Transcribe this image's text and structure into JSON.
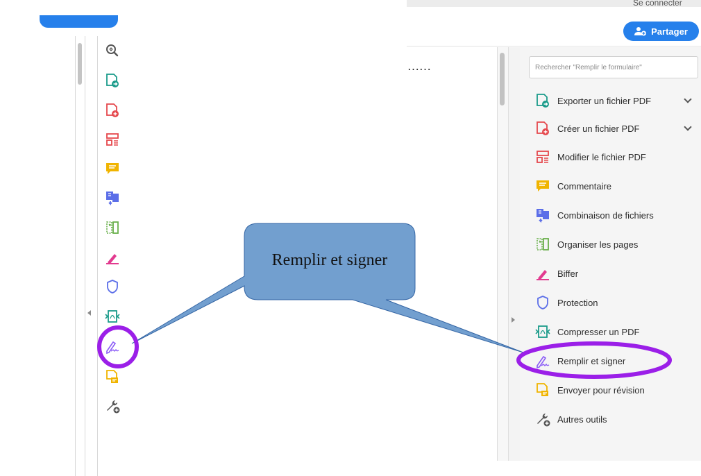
{
  "header": {
    "top_link": "Se connecter",
    "share_label": "Partager"
  },
  "document": {
    "visible_text": "……"
  },
  "tools_pane": {
    "search_placeholder": "Rechercher \"Remplir le formulaire\"",
    "items": [
      {
        "label": "Exporter un fichier PDF",
        "icon": "export-pdf-icon",
        "has_chevron": true
      },
      {
        "label": "Créer un fichier PDF",
        "icon": "create-pdf-icon",
        "has_chevron": true
      },
      {
        "label": "Modifier le fichier PDF",
        "icon": "edit-pdf-icon",
        "has_chevron": false
      },
      {
        "label": "Commentaire",
        "icon": "comment-icon",
        "has_chevron": false
      },
      {
        "label": "Combinaison de fichiers",
        "icon": "combine-files-icon",
        "has_chevron": false
      },
      {
        "label": "Organiser les pages",
        "icon": "organize-pages-icon",
        "has_chevron": false
      },
      {
        "label": "Biffer",
        "icon": "redact-icon",
        "has_chevron": false
      },
      {
        "label": "Protection",
        "icon": "protect-icon",
        "has_chevron": false
      },
      {
        "label": "Compresser un PDF",
        "icon": "compress-pdf-icon",
        "has_chevron": false
      },
      {
        "label": "Remplir et signer",
        "icon": "fill-sign-icon",
        "has_chevron": false
      },
      {
        "label": "Envoyer pour révision",
        "icon": "send-review-icon",
        "has_chevron": false
      },
      {
        "label": "Autres outils",
        "icon": "more-tools-icon",
        "has_chevron": false
      }
    ]
  },
  "left_toolbar": {
    "icons": [
      "zoom-icon",
      "export-pdf-icon",
      "create-pdf-icon",
      "edit-pdf-icon",
      "comment-icon",
      "combine-files-icon",
      "organize-pages-icon",
      "redact-icon",
      "protect-icon",
      "compress-pdf-icon",
      "fill-sign-icon",
      "send-review-icon",
      "more-tools-icon"
    ]
  },
  "annotation": {
    "callout_text": "Remplir et signer"
  },
  "colors": {
    "accent_blue": "#2680eb",
    "callout_fill": "#729fcf",
    "highlight_purple": "#9b1fe8"
  }
}
